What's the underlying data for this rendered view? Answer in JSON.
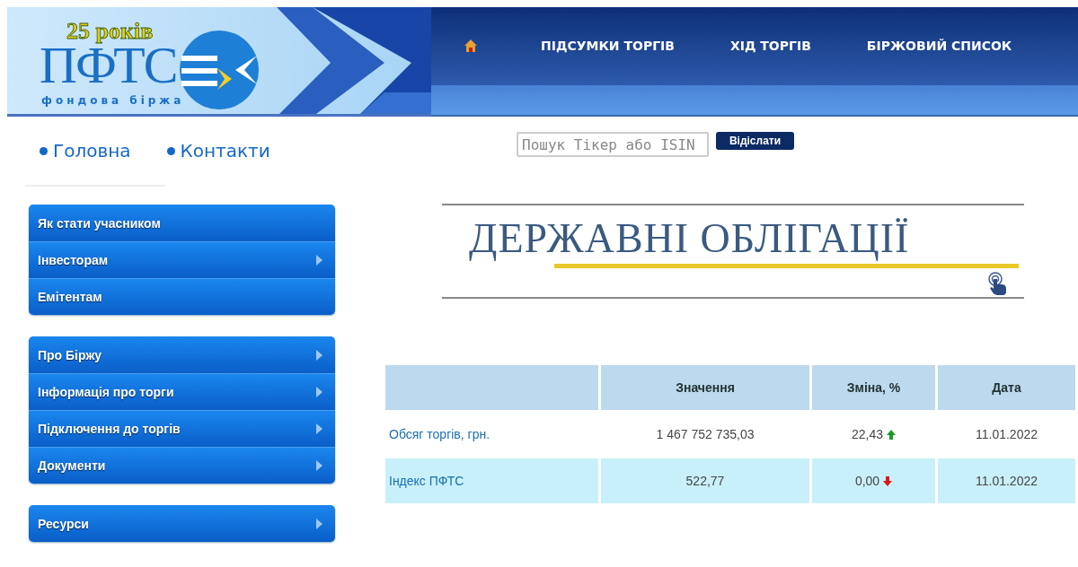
{
  "header": {
    "logo": {
      "anniversary": "25 років",
      "name": "ПФТС",
      "subtitle": "фондова біржа"
    },
    "nav": [
      "ПІДСУМКИ ТОРГІВ",
      "ХІД ТОРГІВ",
      "БІРЖОВИЙ СПИСОК"
    ]
  },
  "top_links": [
    "Головна",
    "Контакти"
  ],
  "menu_groups": [
    {
      "items": [
        {
          "label": "Як стати учасником",
          "submenu": false
        },
        {
          "label": "Інвесторам",
          "submenu": true
        },
        {
          "label": "Емітентам",
          "submenu": false
        }
      ]
    },
    {
      "items": [
        {
          "label": "Про Біржу",
          "submenu": true
        },
        {
          "label": "Інформація про торги",
          "submenu": true
        },
        {
          "label": "Підключення до торгів",
          "submenu": true
        },
        {
          "label": "Документи",
          "submenu": true
        }
      ]
    },
    {
      "items": [
        {
          "label": "Ресурси",
          "submenu": true
        }
      ]
    }
  ],
  "search": {
    "placeholder": "Пошук Тікер або ISIN",
    "button": "Відіслати"
  },
  "banner": {
    "title": "ДЕРЖАВНІ ОБЛІГАЦІЇ"
  },
  "table": {
    "columns": [
      "Значення",
      "Зміна, %",
      "Дата"
    ],
    "rows": [
      {
        "name": "Обсяг торгів, грн.",
        "value": "1 467 752 735,03",
        "change": "22,43",
        "kind": "up",
        "date": "11.01.2022"
      },
      {
        "name": "Індекс ПФТС",
        "value": "522,77",
        "change": "0,00",
        "kind": "down",
        "date": "11.01.2022"
      }
    ]
  }
}
